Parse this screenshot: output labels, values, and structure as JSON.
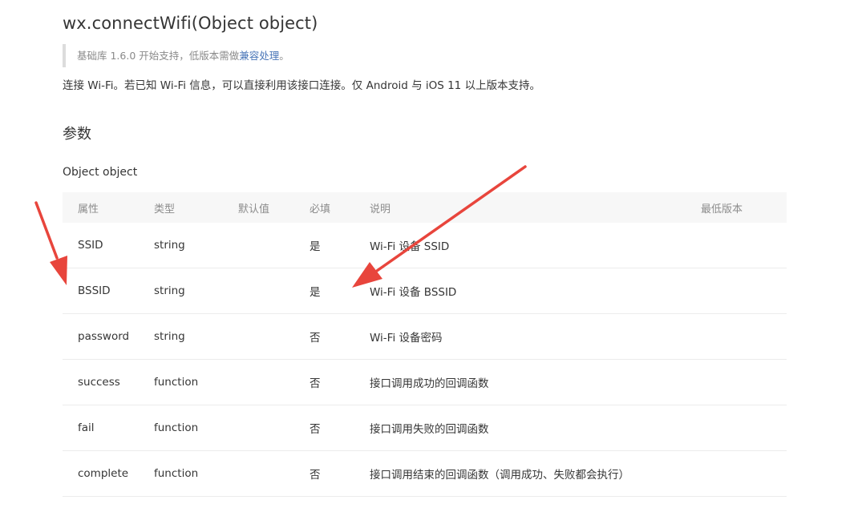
{
  "title": "wx.connectWifi(Object object)",
  "note": {
    "text": "基础库 1.6.0 开始支持，低版本需做",
    "link_label": "兼容处理",
    "suffix": "。"
  },
  "description": "连接 Wi-Fi。若已知 Wi-Fi 信息，可以直接利用该接口连接。仅 Android 与 iOS 11 以上版本支持。",
  "section_heading": "参数",
  "object_label": "Object object",
  "table": {
    "headers": [
      "属性",
      "类型",
      "默认值",
      "必填",
      "说明",
      "最低版本"
    ],
    "rows": [
      {
        "name": "SSID",
        "type": "string",
        "default": "",
        "required": "是",
        "desc": "Wi-Fi 设备 SSID",
        "version": ""
      },
      {
        "name": "BSSID",
        "type": "string",
        "default": "",
        "required": "是",
        "desc": "Wi-Fi 设备 BSSID",
        "version": ""
      },
      {
        "name": "password",
        "type": "string",
        "default": "",
        "required": "否",
        "desc": "Wi-Fi 设备密码",
        "version": ""
      },
      {
        "name": "success",
        "type": "function",
        "default": "",
        "required": "否",
        "desc": "接口调用成功的回调函数",
        "version": ""
      },
      {
        "name": "fail",
        "type": "function",
        "default": "",
        "required": "否",
        "desc": "接口调用失败的回调函数",
        "version": ""
      },
      {
        "name": "complete",
        "type": "function",
        "default": "",
        "required": "否",
        "desc": "接口调用结束的回调函数（调用成功、失败都会执行）",
        "version": ""
      }
    ]
  },
  "annotation_color": "#e8453c"
}
